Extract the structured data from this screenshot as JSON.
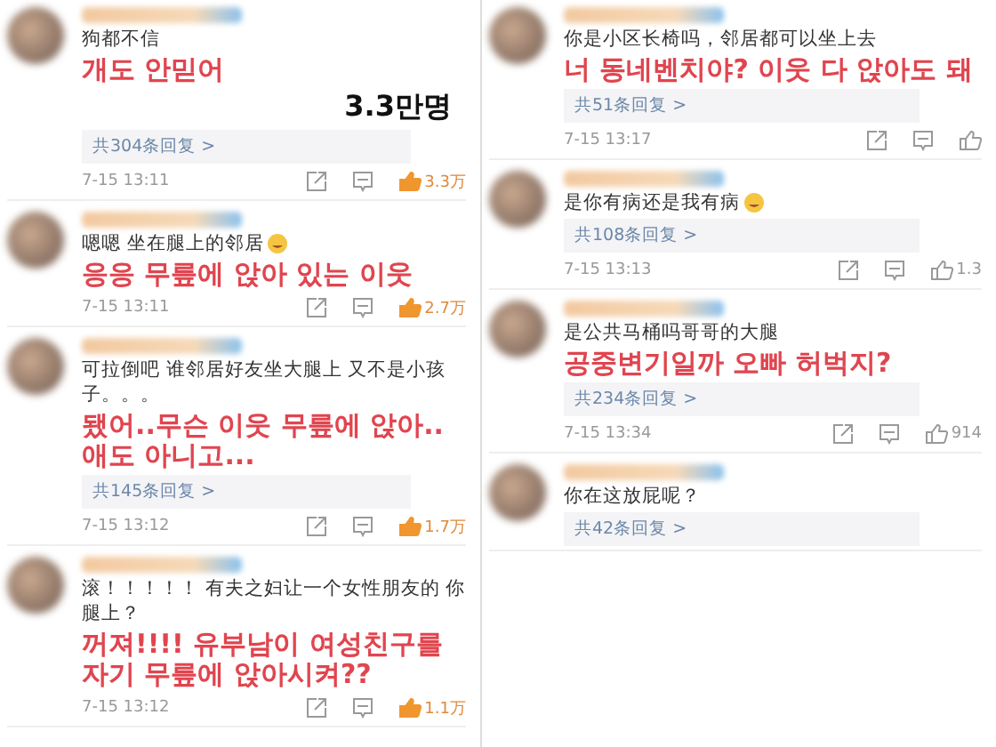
{
  "columns": [
    {
      "comments": [
        {
          "text": "狗都不信",
          "caption": "개도 안믿어",
          "replies": "共304条回复 >",
          "time": "7-15 13:11",
          "likes": "3.3万",
          "liked": true,
          "note": "3.3만명"
        },
        {
          "text": "嗯嗯 坐在腿上的邻居",
          "emoji": true,
          "caption": "응응 무릎에 앉아 있는 이웃",
          "time": "7-15 13:11",
          "likes": "2.7万",
          "liked": true
        },
        {
          "text": "可拉倒吧 谁邻居好友坐大腿上 又不是小孩子。。。",
          "caption": "됐어..무슨 이웃 무릎에 앉아.. 애도 아니고...",
          "replies": "共145条回复 >",
          "time": "7-15 13:12",
          "likes": "1.7万",
          "liked": true
        },
        {
          "text": "滚！！！！！ 有夫之妇让一个女性朋友的 你腿上？",
          "caption": "꺼져!!!! 유부남이 여성친구를 자기 무릎에 앉아시켜??",
          "time": "7-15 13:12",
          "likes": "1.1万",
          "liked": true
        }
      ]
    },
    {
      "comments": [
        {
          "text": "你是小区长椅吗，邻居都可以坐上去",
          "caption": "너 동네벤치야? 이웃 다 앉아도 돼",
          "replies": "共51条回复 >",
          "time": "7-15 13:17",
          "liked": false
        },
        {
          "text": "是你有病还是我有病",
          "emoji": true,
          "replies": "共108条回复 >",
          "time": "7-15 13:13",
          "likes": "1.3",
          "liked": false
        },
        {
          "text": "是公共马桶吗哥哥的大腿",
          "caption": "공중변기일까 오빠 허벅지?",
          "replies": "共234条回复 >",
          "time": "7-15 13:34",
          "likes": "914",
          "liked": false
        },
        {
          "text": "你在这放屁呢？",
          "replies": "共42条回复 >"
        }
      ]
    }
  ]
}
